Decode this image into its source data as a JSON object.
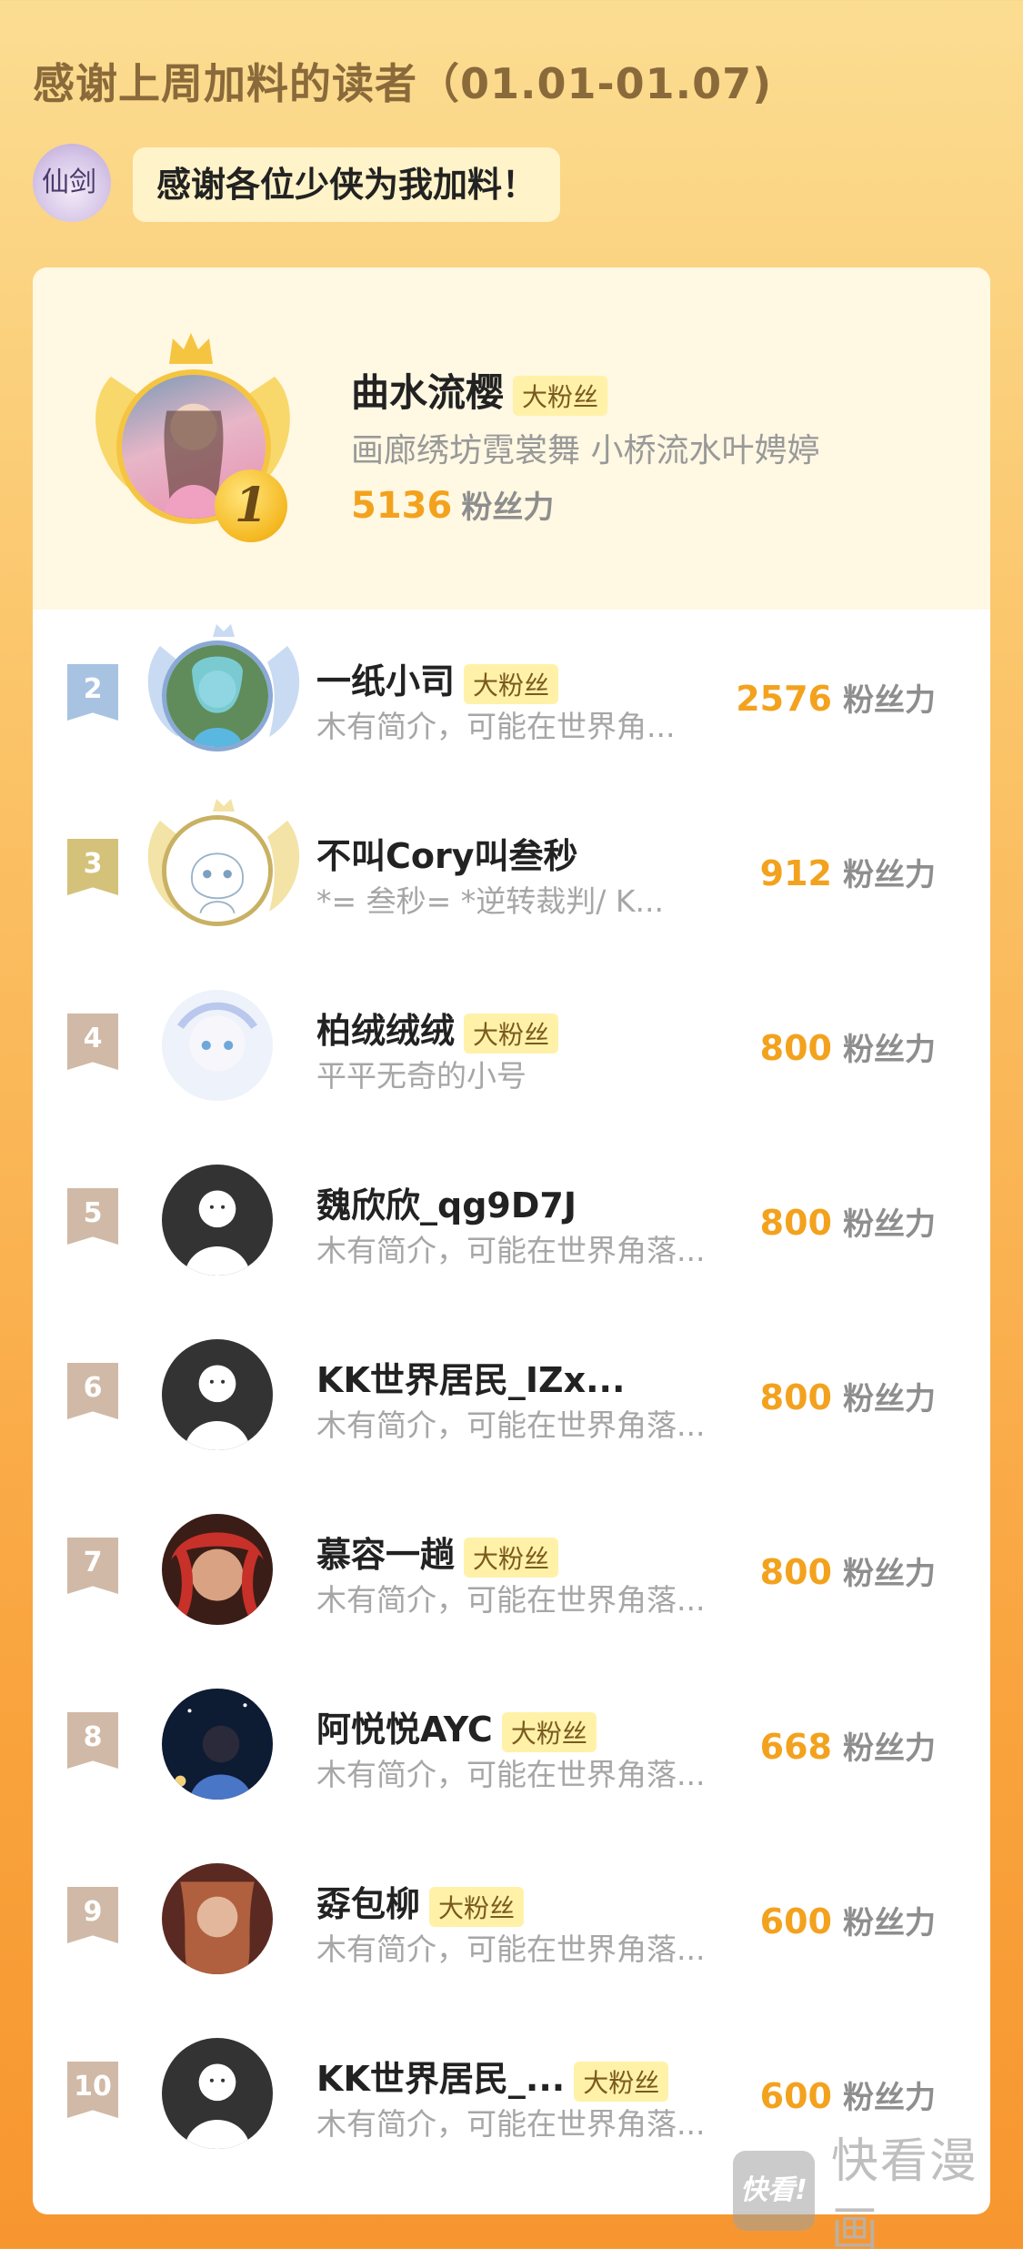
{
  "header": {
    "title": "感谢上周加料的读者（01.01-01.07)",
    "greeting": "感谢各位少侠为我加料！",
    "greeting_avatar": "仙剑"
  },
  "unit": "粉丝力",
  "badge_label": "大粉丝",
  "top_fan": {
    "rank": "1",
    "name": "曲水流樱",
    "badge": "大粉丝",
    "desc": "画廊绣坊霓裳舞 小桥流水叶娉婷",
    "score": "5136",
    "unit": "粉丝力"
  },
  "fans": [
    {
      "rank": "2",
      "name": "一纸小司",
      "badge": "大粉丝",
      "desc": "木有简介，可能在世界角...",
      "score": "2576",
      "unit": "粉丝力"
    },
    {
      "rank": "3",
      "name": "不叫Cory叫叁秒",
      "badge": "",
      "desc": "*= 叁秒= *逆转裁判/ K...",
      "score": "912",
      "unit": "粉丝力"
    },
    {
      "rank": "4",
      "name": "柏绒绒绒",
      "badge": "大粉丝",
      "desc": "平平无奇的小号",
      "score": "800",
      "unit": "粉丝力"
    },
    {
      "rank": "5",
      "name": "魏欣欣_qg9D7J",
      "badge": "",
      "desc": "木有简介，可能在世界角落...",
      "score": "800",
      "unit": "粉丝力"
    },
    {
      "rank": "6",
      "name": "KK世界居民_IZx...",
      "badge": "",
      "desc": "木有简介，可能在世界角落...",
      "score": "800",
      "unit": "粉丝力"
    },
    {
      "rank": "7",
      "name": "慕容一趟",
      "badge": "大粉丝",
      "desc": "木有简介，可能在世界角落...",
      "score": "800",
      "unit": "粉丝力"
    },
    {
      "rank": "8",
      "name": "阿悦悦AYC",
      "badge": "大粉丝",
      "desc": "木有简介，可能在世界角落...",
      "score": "668",
      "unit": "粉丝力"
    },
    {
      "rank": "9",
      "name": "孬包柳",
      "badge": "大粉丝",
      "desc": "木有简介，可能在世界角落...",
      "score": "600",
      "unit": "粉丝力"
    },
    {
      "rank": "10",
      "name": "KK世界居民_...",
      "badge": "大粉丝",
      "desc": "木有简介，可能在世界角落...",
      "score": "600",
      "unit": "粉丝力"
    }
  ],
  "watermark": {
    "logo": "快看!",
    "text": "快看漫画"
  },
  "colors": {
    "accent": "#f3a21e",
    "badge_bg": "#fff1a8",
    "top_bg": "#fff8e3"
  }
}
